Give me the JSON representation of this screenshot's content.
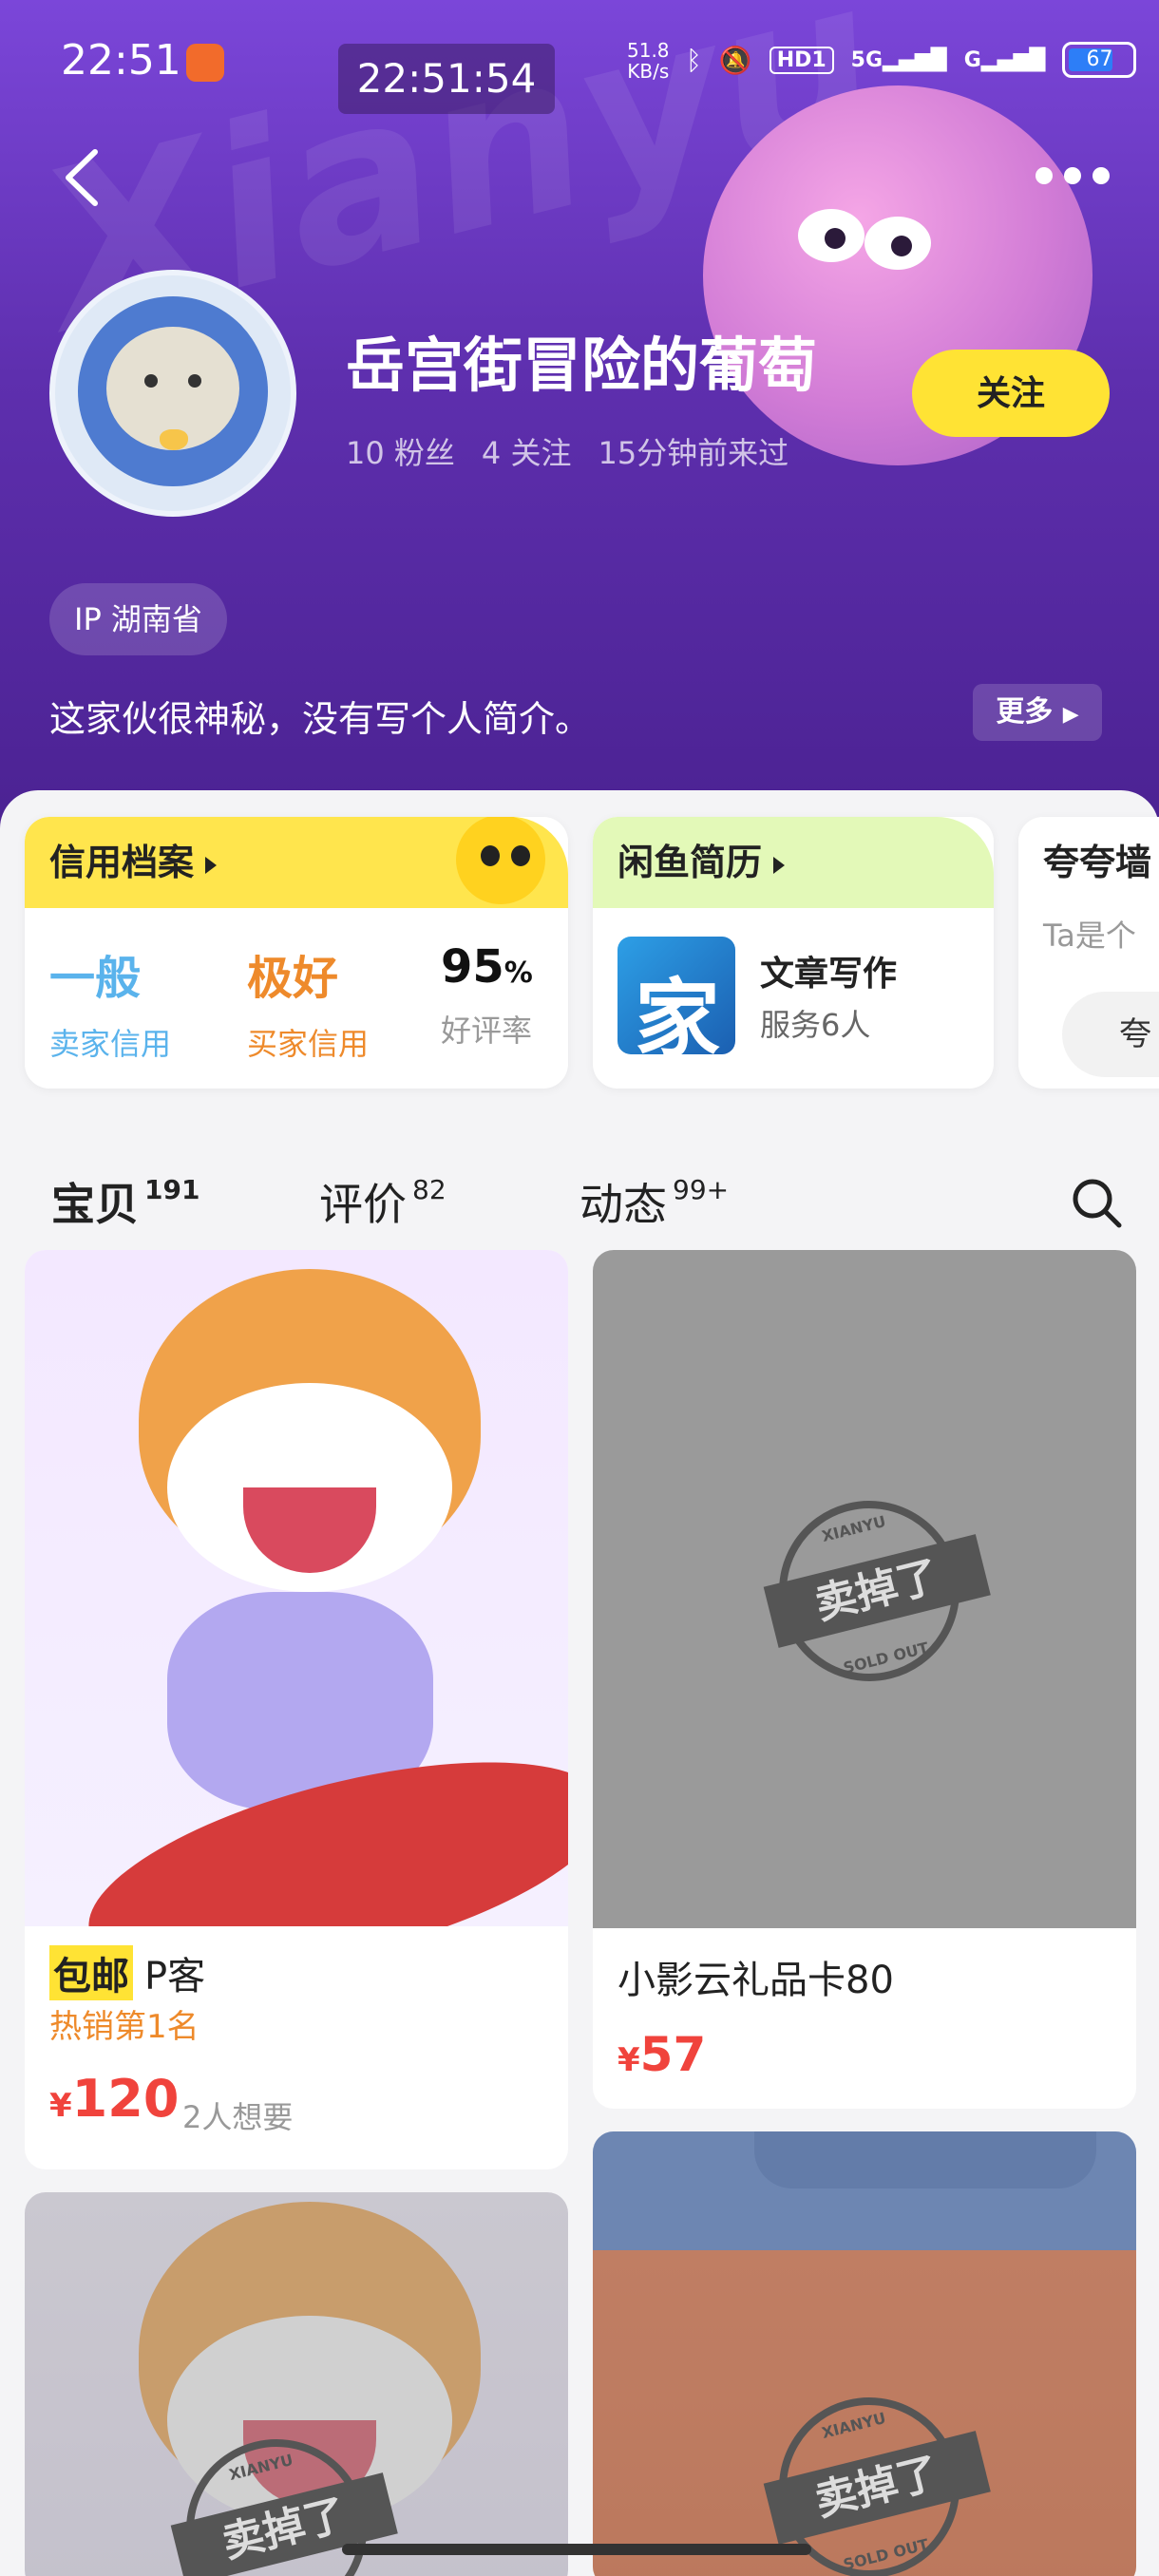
{
  "status_bar": {
    "time": "22:51",
    "clock_overlay": "22:51:54",
    "net_speed_value": "51.8",
    "net_speed_unit": "KB/s",
    "hd_label": "HD1",
    "network": "5G",
    "network2": "G",
    "battery": "67"
  },
  "header": {
    "watermark": "Xianyu",
    "username": "岳宫街冒险的葡萄",
    "follow_label": "关注",
    "fans": "10 粉丝",
    "following": "4 关注",
    "last_seen": "15分钟前来过",
    "ip_label": "IP 湖南省",
    "bio": "这家伙很神秘，没有写个人简介。",
    "more_label": "更多"
  },
  "credit_card": {
    "title": "信用档案",
    "seller_credit_value": "一般",
    "seller_credit_label": "卖家信用",
    "buyer_credit_value": "极好",
    "buyer_credit_label": "买家信用",
    "good_rate_value": "95",
    "good_rate_unit": "%",
    "good_rate_label": "好评率"
  },
  "resume_card": {
    "title": "闲鱼简历",
    "service_icon_char": "家",
    "service_title": "文章写作",
    "service_sub": "服务6人"
  },
  "praise_card": {
    "title": "夸夸墙",
    "sub": "Ta是个",
    "button": "夸"
  },
  "tabs": [
    {
      "label": "宝贝",
      "count": "191"
    },
    {
      "label": "评价",
      "count": "82"
    },
    {
      "label": "动态",
      "count": "99+"
    }
  ],
  "items": [
    {
      "tag": "包邮",
      "title": "P客",
      "hot": "热销第1名",
      "currency": "¥",
      "price": "120",
      "want": "2人想要"
    },
    {
      "title": "小影云礼品卡80",
      "currency": "¥",
      "price": "57",
      "sold": "卖掉了"
    },
    {
      "sold": "卖掉了"
    },
    {
      "sold": "卖掉了"
    }
  ],
  "stamp": {
    "top": "XIANYU",
    "bottom": "SOLD OUT"
  },
  "colors": {
    "header_purple": "#5e2fae",
    "accent_yellow": "#ffe334",
    "price_red": "#f0433c",
    "seller_blue": "#5ab3ec",
    "buyer_orange": "#ee8a2b"
  }
}
